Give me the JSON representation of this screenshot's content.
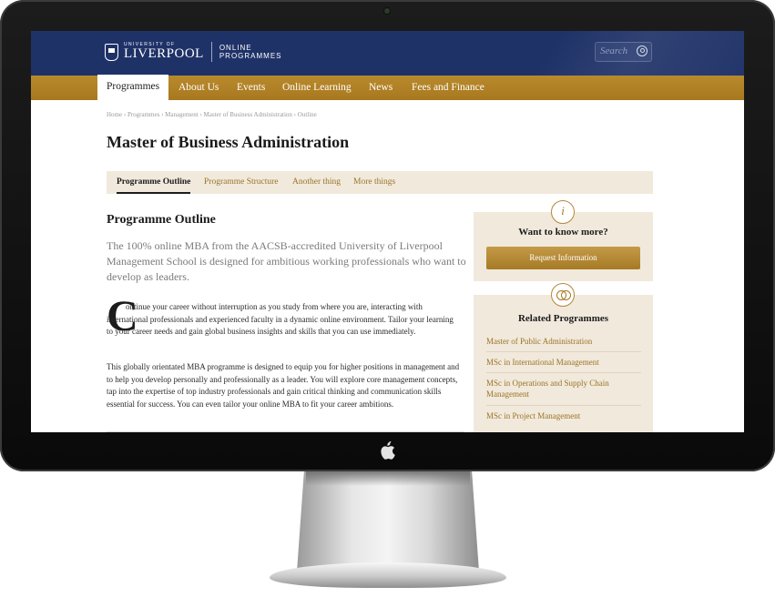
{
  "header": {
    "logo_small": "UNIVERSITY OF",
    "logo_big": "LIVERPOOL",
    "logo_online_1": "ONLINE",
    "logo_online_2": "PROGRAMMES",
    "search_placeholder": "Search"
  },
  "nav": {
    "items": [
      {
        "label": "Programmes"
      },
      {
        "label": "About Us"
      },
      {
        "label": "Events"
      },
      {
        "label": "Online Learning"
      },
      {
        "label": "News"
      },
      {
        "label": "Fees and Finance"
      }
    ]
  },
  "breadcrumb": "Home › Programmes › Management › Master of Business Administration › Outline",
  "page_title": "Master of Business Administration",
  "tabs": [
    {
      "label": "Programme Outline"
    },
    {
      "label": "Programme Structure"
    },
    {
      "label": "Another thing"
    },
    {
      "label": "More things"
    }
  ],
  "content": {
    "heading": "Programme Outline",
    "intro": "The 100% online MBA from the AACSB-accredited University of Liverpool Management School is designed for ambitious working professionals who want to develop as leaders.",
    "dropcap": "C",
    "para1": "ontinue your career without interruption as you study from where you are, interacting with international professionals and experienced faculty in a dynamic online environment. Tailor your learning to your career needs and gain global business insights and skills that you can use immediately.",
    "para2": "This globally orientated MBA programme is designed to equip you for higher positions in management and to help you develop personally and professionally as a leader. You will explore core management concepts, tap into the expertise of top industry professionals and gain critical thinking and communication skills essential for success. You can even tailor your online MBA to fit your career ambitions."
  },
  "sidebar": {
    "know_more_title": "Want to know more?",
    "request_button": "Request Information",
    "related_title": "Related Programmes",
    "related": [
      "Master of Public Administration",
      "MSc in International Management",
      "MSc in Operations and Supply Chain Management",
      "MSc in Project Management"
    ]
  },
  "colors": {
    "navy": "#1f3268",
    "gold": "#a87820",
    "beige": "#f1e9dc"
  }
}
